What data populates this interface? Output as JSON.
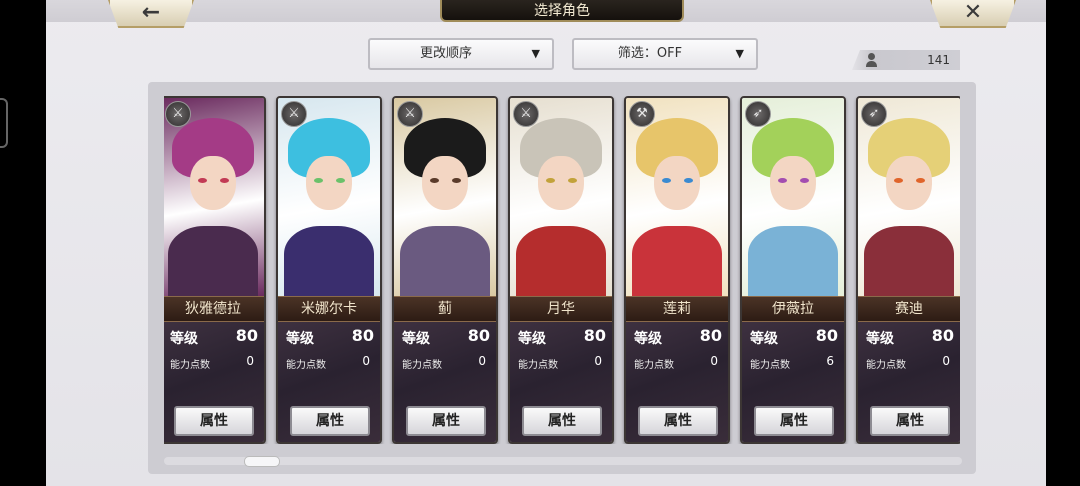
{
  "header": {
    "title": "选择角色",
    "back_icon": "←",
    "close_icon": "✕"
  },
  "toolbar": {
    "sort_label": "更改顺序",
    "filter_label": "筛选：OFF",
    "dropdown_chevron": "▼",
    "character_count": "141"
  },
  "cards": [
    {
      "name": "狄雅德拉",
      "level_label": "等级",
      "level": "80",
      "ap_label": "能力点数",
      "ap": "0",
      "button": "属性",
      "role_icon": "⚔",
      "hair": "#a43b86",
      "eye": "#c23a54",
      "outfit": "#4a2b4e",
      "portrait_bg": "#6a2a5e"
    },
    {
      "name": "米娜尔卡",
      "level_label": "等级",
      "level": "80",
      "ap_label": "能力点数",
      "ap": "0",
      "button": "属性",
      "role_icon": "⚔",
      "hair": "#3dbfe0",
      "eye": "#6ac16a",
      "outfit": "#3a2e6e",
      "portrait_bg": "#d7e7ef"
    },
    {
      "name": "蓟",
      "level_label": "等级",
      "level": "80",
      "ap_label": "能力点数",
      "ap": "0",
      "button": "属性",
      "role_icon": "⚔",
      "hair": "#1b1b1b",
      "eye": "#5a3b2a",
      "outfit": "#6a5a80",
      "portrait_bg": "#d9c9a2"
    },
    {
      "name": "月华",
      "level_label": "等级",
      "level": "80",
      "ap_label": "能力点数",
      "ap": "0",
      "button": "属性",
      "role_icon": "⚔",
      "hair": "#c9c4b8",
      "eye": "#c2a23a",
      "outfit": "#b52d2d",
      "portrait_bg": "#e6dfd0"
    },
    {
      "name": "莲莉",
      "level_label": "等级",
      "level": "80",
      "ap_label": "能力点数",
      "ap": "0",
      "button": "属性",
      "role_icon": "⚒",
      "hair": "#e7c56a",
      "eye": "#3a8ad1",
      "outfit": "#c9333a",
      "portrait_bg": "#f1e2c0"
    },
    {
      "name": "伊薇拉",
      "level_label": "等级",
      "level": "80",
      "ap_label": "能力点数",
      "ap": "6",
      "button": "属性",
      "role_icon": "➶",
      "hair": "#a3d15a",
      "eye": "#a34db0",
      "outfit": "#7ab2d6",
      "portrait_bg": "#e5efd9"
    },
    {
      "name": "赛迪",
      "level_label": "等级",
      "level": "80",
      "ap_label": "能力点数",
      "ap": "0",
      "button": "属性",
      "role_icon": "➶",
      "hair": "#e5d077",
      "eye": "#e0642a",
      "outfit": "#8a2f3a",
      "portrait_bg": "#efe8d6"
    }
  ]
}
